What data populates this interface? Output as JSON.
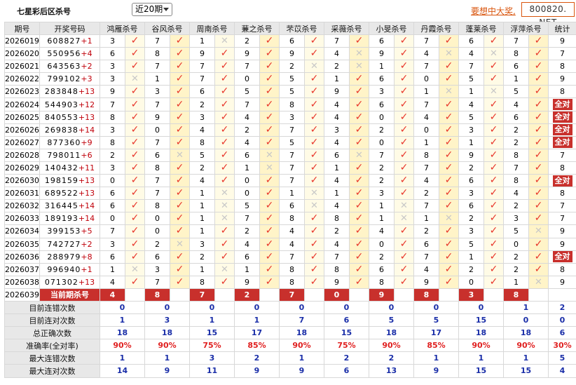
{
  "header": {
    "title": "七星彩后区杀号",
    "period_select": "近20期",
    "promo_link": "要想中大奖,",
    "site_label": "800820. NET"
  },
  "columns": {
    "period": "期号",
    "draw": "开奖号码",
    "experts": [
      "鸿雁杀号",
      "谷风杀号",
      "周南杀号",
      "蒹之杀号",
      "芣苡杀号",
      "采薇杀号",
      "小旻杀号",
      "丹霞杀号",
      "蓬莱杀号",
      "浮萍杀号"
    ],
    "stat": "统计"
  },
  "rows": [
    {
      "period": "2026019",
      "draw": "608827",
      "sum": "+1",
      "kills": [
        "3",
        "7",
        "1",
        "2",
        "6",
        "7",
        "6",
        "7",
        "6",
        "7"
      ],
      "hits": [
        1,
        1,
        0,
        1,
        1,
        1,
        1,
        1,
        1,
        1
      ],
      "stat": "9"
    },
    {
      "period": "2026020",
      "draw": "550956",
      "sum": "+4",
      "kills": [
        "6",
        "8",
        "9",
        "9",
        "9",
        "4",
        "9",
        "4",
        "4",
        "8"
      ],
      "hits": [
        1,
        1,
        1,
        1,
        1,
        0,
        1,
        0,
        0,
        1
      ],
      "stat": "7"
    },
    {
      "period": "2026021",
      "draw": "643563",
      "sum": "+2",
      "kills": [
        "3",
        "7",
        "7",
        "7",
        "2",
        "2",
        "1",
        "7",
        "7",
        "6"
      ],
      "hits": [
        1,
        1,
        1,
        1,
        0,
        0,
        1,
        1,
        1,
        1
      ],
      "stat": "8"
    },
    {
      "period": "2026022",
      "draw": "799102",
      "sum": "+3",
      "kills": [
        "3",
        "1",
        "7",
        "0",
        "5",
        "1",
        "6",
        "0",
        "5",
        "1"
      ],
      "hits": [
        0,
        1,
        1,
        1,
        1,
        1,
        1,
        1,
        1,
        1
      ],
      "stat": "9"
    },
    {
      "period": "2026023",
      "draw": "283848",
      "sum": "+13",
      "kills": [
        "9",
        "3",
        "6",
        "5",
        "5",
        "9",
        "3",
        "1",
        "1",
        "5"
      ],
      "hits": [
        1,
        1,
        1,
        1,
        1,
        1,
        1,
        0,
        0,
        1
      ],
      "stat": "8"
    },
    {
      "period": "2026024",
      "draw": "544903",
      "sum": "+12",
      "kills": [
        "7",
        "7",
        "2",
        "7",
        "8",
        "4",
        "6",
        "7",
        "4",
        "4"
      ],
      "hits": [
        1,
        1,
        1,
        1,
        1,
        1,
        1,
        1,
        1,
        1
      ],
      "stat": "全对"
    },
    {
      "period": "2026025",
      "draw": "840553",
      "sum": "+13",
      "kills": [
        "8",
        "9",
        "3",
        "4",
        "3",
        "4",
        "0",
        "4",
        "5",
        "6"
      ],
      "hits": [
        1,
        1,
        1,
        1,
        1,
        1,
        1,
        1,
        1,
        1
      ],
      "stat": "全对"
    },
    {
      "period": "2026026",
      "draw": "269838",
      "sum": "+14",
      "kills": [
        "3",
        "0",
        "4",
        "2",
        "7",
        "3",
        "2",
        "0",
        "3",
        "2"
      ],
      "hits": [
        1,
        1,
        1,
        1,
        1,
        1,
        1,
        1,
        1,
        1
      ],
      "stat": "全对"
    },
    {
      "period": "2026027",
      "draw": "877360",
      "sum": "+9",
      "kills": [
        "8",
        "7",
        "8",
        "4",
        "5",
        "4",
        "0",
        "1",
        "1",
        "2"
      ],
      "hits": [
        1,
        1,
        1,
        1,
        1,
        1,
        1,
        1,
        1,
        1
      ],
      "stat": "全对"
    },
    {
      "period": "2026028",
      "draw": "798011",
      "sum": "+6",
      "kills": [
        "2",
        "6",
        "5",
        "6",
        "7",
        "6",
        "7",
        "8",
        "9",
        "8"
      ],
      "hits": [
        1,
        0,
        1,
        0,
        1,
        0,
        1,
        1,
        1,
        1
      ],
      "stat": "7"
    },
    {
      "period": "2026029",
      "draw": "140432",
      "sum": "+11",
      "kills": [
        "3",
        "8",
        "2",
        "1",
        "7",
        "1",
        "2",
        "7",
        "2",
        "7"
      ],
      "hits": [
        1,
        1,
        1,
        0,
        1,
        1,
        1,
        1,
        1,
        1
      ],
      "stat": "8"
    },
    {
      "period": "2026030",
      "draw": "198159",
      "sum": "+13",
      "kills": [
        "0",
        "7",
        "4",
        "0",
        "7",
        "4",
        "2",
        "4",
        "6",
        "8"
      ],
      "hits": [
        1,
        1,
        1,
        1,
        1,
        1,
        1,
        1,
        1,
        1
      ],
      "stat": "全对"
    },
    {
      "period": "2026031",
      "draw": "689522",
      "sum": "+13",
      "kills": [
        "6",
        "7",
        "1",
        "0",
        "1",
        "1",
        "3",
        "2",
        "3",
        "4"
      ],
      "hits": [
        1,
        1,
        0,
        1,
        0,
        1,
        1,
        1,
        1,
        1
      ],
      "stat": "8"
    },
    {
      "period": "2026032",
      "draw": "316445",
      "sum": "+14",
      "kills": [
        "6",
        "8",
        "1",
        "5",
        "6",
        "4",
        "1",
        "7",
        "6",
        "2"
      ],
      "hits": [
        1,
        1,
        0,
        1,
        0,
        1,
        0,
        1,
        1,
        1
      ],
      "stat": "7"
    },
    {
      "period": "2026033",
      "draw": "189193",
      "sum": "+14",
      "kills": [
        "0",
        "0",
        "1",
        "7",
        "8",
        "8",
        "1",
        "1",
        "2",
        "3"
      ],
      "hits": [
        1,
        1,
        0,
        1,
        1,
        1,
        0,
        0,
        1,
        1
      ],
      "stat": "7"
    },
    {
      "period": "2026034",
      "draw": "399153",
      "sum": "+5",
      "kills": [
        "7",
        "0",
        "1",
        "2",
        "4",
        "2",
        "4",
        "2",
        "3",
        "5"
      ],
      "hits": [
        1,
        1,
        1,
        1,
        1,
        1,
        1,
        1,
        1,
        0
      ],
      "stat": "9"
    },
    {
      "period": "2026035",
      "draw": "742727",
      "sum": "+2",
      "kills": [
        "3",
        "2",
        "3",
        "4",
        "4",
        "4",
        "0",
        "6",
        "5",
        "0"
      ],
      "hits": [
        1,
        0,
        1,
        1,
        1,
        1,
        1,
        1,
        1,
        1
      ],
      "stat": "9"
    },
    {
      "period": "2026036",
      "draw": "288979",
      "sum": "+8",
      "kills": [
        "6",
        "6",
        "2",
        "6",
        "7",
        "7",
        "2",
        "7",
        "1",
        "2"
      ],
      "hits": [
        1,
        1,
        1,
        1,
        1,
        1,
        1,
        1,
        1,
        1
      ],
      "stat": "全对"
    },
    {
      "period": "2026037",
      "draw": "996940",
      "sum": "+1",
      "kills": [
        "1",
        "3",
        "1",
        "1",
        "8",
        "8",
        "6",
        "4",
        "2",
        "2"
      ],
      "hits": [
        0,
        1,
        0,
        1,
        1,
        1,
        1,
        1,
        1,
        1
      ],
      "stat": "8"
    },
    {
      "period": "2026038",
      "draw": "071302",
      "sum": "+13",
      "kills": [
        "4",
        "7",
        "8",
        "9",
        "8",
        "9",
        "8",
        "9",
        "0",
        "1"
      ],
      "hits": [
        1,
        1,
        1,
        1,
        1,
        1,
        1,
        1,
        1,
        0
      ],
      "stat": "9"
    }
  ],
  "current": {
    "period": "2026039",
    "label": "当前期杀号",
    "kills": [
      "4",
      "8",
      "7",
      "2",
      "7",
      "0",
      "9",
      "8",
      "3",
      "8"
    ]
  },
  "summary": [
    {
      "label": "目前连错次数",
      "values": [
        "0",
        "0",
        "0",
        "0",
        "0",
        "0",
        "0",
        "0",
        "0",
        "1"
      ],
      "stat": "2",
      "pct": false
    },
    {
      "label": "目前连对次数",
      "values": [
        "1",
        "3",
        "1",
        "1",
        "7",
        "6",
        "5",
        "5",
        "15",
        "0"
      ],
      "stat": "0",
      "pct": false
    },
    {
      "label": "总正确次数",
      "values": [
        "18",
        "18",
        "15",
        "17",
        "18",
        "15",
        "18",
        "17",
        "18",
        "18"
      ],
      "stat": "6",
      "pct": false
    },
    {
      "label": "准确率(全对率)",
      "values": [
        "90%",
        "90%",
        "75%",
        "85%",
        "90%",
        "75%",
        "90%",
        "85%",
        "90%",
        "90%"
      ],
      "stat": "30%",
      "pct": true
    },
    {
      "label": "最大连错次数",
      "values": [
        "1",
        "1",
        "3",
        "2",
        "1",
        "2",
        "2",
        "1",
        "1",
        "1"
      ],
      "stat": "5",
      "pct": false
    },
    {
      "label": "最大连对次数",
      "values": [
        "14",
        "9",
        "11",
        "9",
        "9",
        "6",
        "13",
        "9",
        "15",
        "15"
      ],
      "stat": "4",
      "pct": false
    }
  ],
  "symbols": {
    "hit": "✓",
    "miss": "✕"
  },
  "colors": {
    "hit": "#e8352a",
    "miss": "#c8c8c8",
    "highlight": "#c8302c",
    "summary_value": "#1a2ea8",
    "pct_value": "#e02020"
  }
}
